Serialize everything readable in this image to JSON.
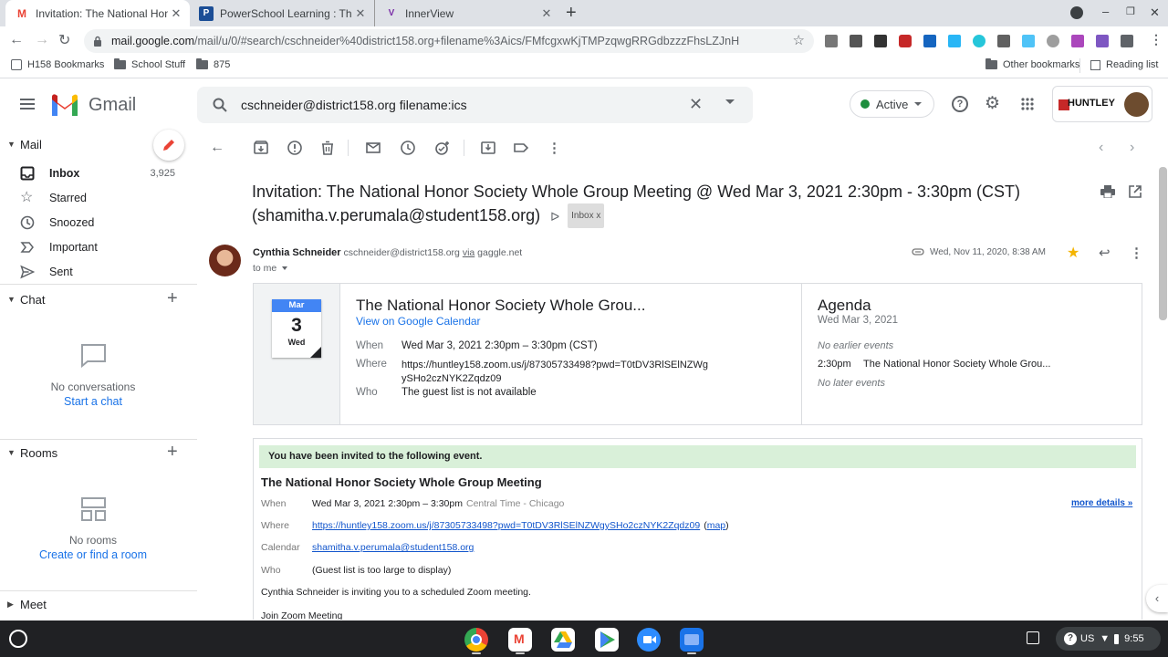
{
  "browser": {
    "tabs": [
      {
        "title": "Invitation: The National Honor S",
        "favicon": "M",
        "active": true
      },
      {
        "title": "PowerSchool Learning : The Nat",
        "favicon": "P",
        "active": false
      },
      {
        "title": "InnerView",
        "favicon": "V",
        "active": false
      }
    ],
    "new_tab": "+",
    "url_host": "mail.google.com",
    "url_path": "/mail/u/0/#search/cschneider%40district158.org+filename%3Aics/FMfcgxwKjTMPzqwgRRGdbzzzFhsLZJnH",
    "bookmarks": [
      "H158 Bookmarks",
      "School Stuff",
      "875"
    ],
    "other_bookmarks": "Other bookmarks",
    "reading_list": "Reading list"
  },
  "gmail": {
    "logo_text": "Gmail",
    "search_value": "cschneider@district158.org filename:ics",
    "status": "Active",
    "org_logo": "HUNTLEY"
  },
  "sidebar": {
    "mail_label": "Mail",
    "items": [
      {
        "label": "Inbox",
        "count": "3,925",
        "icon": "inbox-icon"
      },
      {
        "label": "Starred",
        "count": "",
        "icon": "star-icon"
      },
      {
        "label": "Snoozed",
        "count": "",
        "icon": "clock-icon"
      },
      {
        "label": "Important",
        "count": "",
        "icon": "important-icon"
      },
      {
        "label": "Sent",
        "count": "",
        "icon": "send-icon"
      }
    ],
    "chat_label": "Chat",
    "chat_empty": "No conversations",
    "chat_link": "Start a chat",
    "rooms_label": "Rooms",
    "rooms_empty": "No rooms",
    "rooms_link": "Create or find a room",
    "meet_label": "Meet"
  },
  "email": {
    "subject_line1": "Invitation: The National Honor Society Whole Group Meeting @ Wed Mar 3, 2021 2:30pm - 3:30pm (CST)",
    "subject_line2": "(shamitha.v.perumala@student158.org)",
    "label_chip": "Inbox",
    "label_chip_x": "x",
    "sender_name": "Cynthia Schneider",
    "sender_email": "cschneider@district158.org",
    "via_word": "via",
    "via_domain": "gaggle.net",
    "to": "to me",
    "date": "Wed, Nov 11, 2020, 8:38 AM"
  },
  "calendar_card": {
    "month": "Mar",
    "day": "3",
    "weekday": "Wed",
    "title": "The National Honor Society Whole Grou...",
    "view_link": "View on Google Calendar",
    "when_label": "When",
    "when_value": "Wed Mar 3, 2021 2:30pm – 3:30pm (CST)",
    "where_label": "Where",
    "where_value_1": "https://huntley158.zoom.us/j/87305733498?pwd=T0tDV3RlSElNZWg",
    "where_value_2": "ySHo2czNYK2Zqdz09",
    "who_label": "Who",
    "who_value": "The guest list is not available",
    "agenda_title": "Agenda",
    "agenda_date": "Wed Mar 3, 2021",
    "agenda_no_earlier": "No earlier events",
    "agenda_time": "2:30pm",
    "agenda_event": "The National Honor Society Whole Grou...",
    "agenda_no_later": "No later events"
  },
  "invite": {
    "banner": "You have been invited to the following event.",
    "title": "The National Honor Society Whole Group Meeting",
    "when_label": "When",
    "when_value": "Wed Mar 3, 2021 2:30pm – 3:30pm",
    "timezone": "Central Time - Chicago",
    "more_details": "more details »",
    "where_label": "Where",
    "where_link": "https://huntley158.zoom.us/j/87305733498?pwd=T0tDV3RlSElNZWgySHo2czNYK2Zqdz09",
    "map_link": "map",
    "calendar_label": "Calendar",
    "calendar_value": "shamitha.v.perumala@student158.org",
    "who_label": "Who",
    "who_value": "(Guest list is too large to display)",
    "body_line1": "Cynthia Schneider is inviting you to a scheduled Zoom meeting.",
    "body_line2": "Join Zoom Meeting"
  },
  "shelf": {
    "locale": "US",
    "time": "9:55"
  },
  "colors": {
    "gmail_red": "#ea4335",
    "link_blue": "#1a73e8",
    "banner_green": "#d9f0d9",
    "active_green": "#1e8e3e",
    "star_yellow": "#f4b400"
  }
}
